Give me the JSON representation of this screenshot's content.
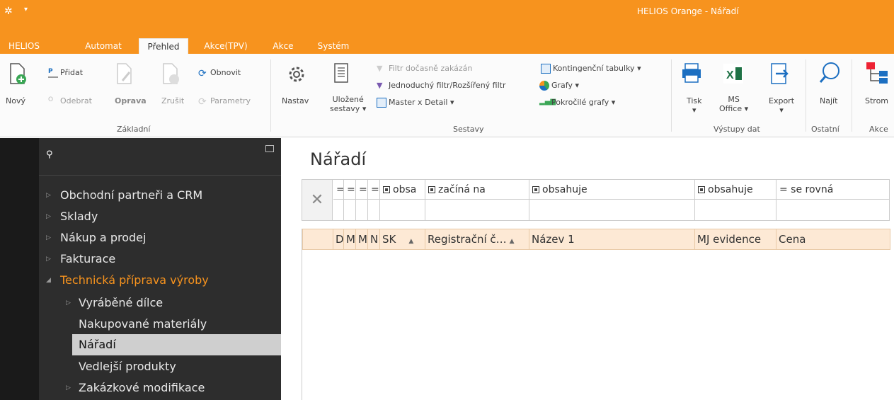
{
  "titlebar": {
    "title": "HELIOS Orange - Nářadí"
  },
  "tabs": [
    {
      "label": "HELIOS"
    },
    {
      "label": "Automat"
    },
    {
      "label": "Přehled"
    },
    {
      "label": "Akce(TPV)"
    },
    {
      "label": "Akce"
    },
    {
      "label": "Systém"
    }
  ],
  "ribbon": {
    "novy": "Nový",
    "pridat": "Přidat",
    "odebrat": "Odebrat",
    "oprava": "Oprava",
    "zrusit": "Zrušit",
    "obnovit": "Obnovit",
    "parametry": "Parametry",
    "group_zakladni": "Základní",
    "nastav": "Nastav",
    "ulozene": "Uložené",
    "sestavy": "sestavy",
    "filtr_docasne": "Filtr dočasně zakázán",
    "jednoduchy_filtr": "Jednoduchý filtr/Rozšířený filtr",
    "master_detail": "Master x Detail",
    "kontingencni": "Kontingenční tabulky",
    "grafy": "Grafy",
    "pokrocile_grafy": "Pokročilé grafy",
    "group_sestavy": "Sestavy",
    "tisk": "Tisk",
    "ms": "MS",
    "office": "Office",
    "export": "Export",
    "group_vystupy": "Výstupy dat",
    "najit": "Najít",
    "group_ostatni": "Ostatní",
    "strom": "Strom",
    "group_akce": "Akce"
  },
  "sidebar": {
    "items": [
      {
        "label": "Obchodní partneři a CRM"
      },
      {
        "label": "Sklady"
      },
      {
        "label": "Nákup a prodej"
      },
      {
        "label": "Fakturace"
      },
      {
        "label": "Technická příprava výroby"
      },
      {
        "label": "Vyráběné dílce"
      },
      {
        "label": "Nakupované materiály"
      },
      {
        "label": "Nářadí"
      },
      {
        "label": "Vedlejší produkty"
      },
      {
        "label": "Zakázkové modifikace"
      }
    ]
  },
  "main": {
    "title": "Nářadí",
    "filter_ops": [
      "=",
      "=",
      "=",
      "=",
      "obsa",
      "začíná na",
      "obsahuje",
      "obsahuje",
      "= se rovná"
    ],
    "columns": [
      "D",
      "M.",
      "M.",
      "N",
      "SK",
      "Registrační č…",
      "Název 1",
      "MJ evidence",
      "Cena"
    ]
  },
  "colors": {
    "accent": "#f7931e",
    "sidebar_bg": "#2d2d2d",
    "active_nav": "#f7931e",
    "grid_header_bg": "#fde9d5"
  }
}
